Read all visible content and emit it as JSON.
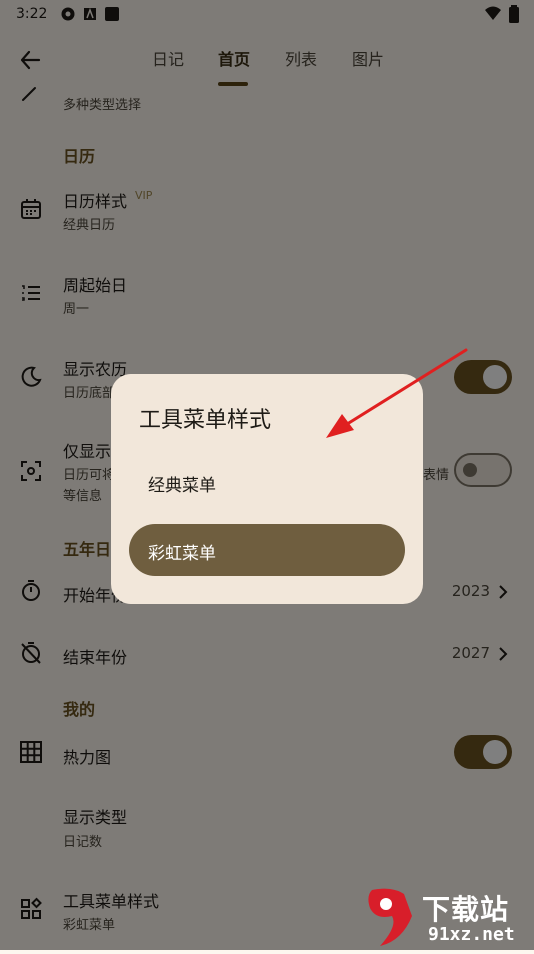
{
  "status_bar": {
    "time": "3:22",
    "icons": [
      "gear-like-icon",
      "a-box-icon",
      "square-icon",
      "wifi-icon",
      "battery-icon"
    ]
  },
  "app_bar": {
    "tabs": [
      {
        "label": "日记"
      },
      {
        "label": "首页"
      },
      {
        "label": "列表"
      },
      {
        "label": "图片"
      }
    ],
    "active_tab": "首页"
  },
  "settings": {
    "partial_top_sub": "多种类型选择",
    "calendar_section": "日历",
    "calendar_style": {
      "title": "日历样式",
      "badge": "VIP",
      "sub": "经典日历"
    },
    "week_start": {
      "title": "周起始日",
      "sub": "周一"
    },
    "lunar": {
      "title": "显示农历",
      "sub": "日历底部",
      "enabled": true
    },
    "only_show": {
      "title": "仅显示",
      "sub": "日历可将",
      "sub2": "等信息",
      "right_text": "表情",
      "enabled": false
    },
    "five_year_section": "五年日",
    "start_year": {
      "title": "开始年份",
      "value": "2023"
    },
    "end_year": {
      "title": "结束年份",
      "value": "2027"
    },
    "mine_section": "我的",
    "heatmap": {
      "title": "热力图",
      "enabled": true
    },
    "display_type": {
      "title": "显示类型",
      "sub": "日记数"
    },
    "toolbar_style": {
      "title": "工具菜单样式",
      "sub": "彩虹菜单"
    }
  },
  "dialog": {
    "title": "工具菜单样式",
    "options": [
      {
        "label": "经典菜单",
        "selected": false
      },
      {
        "label": "彩虹菜单",
        "selected": true
      }
    ]
  },
  "watermark": {
    "brand": "下载站",
    "url": "91xz.net",
    "logo": "9"
  },
  "colors": {
    "accent": "#6a5220",
    "section": "#6b5320",
    "dialog_bg": "#f2e7da",
    "selected_option": "#6f5e3f",
    "arrow": "#e02020"
  }
}
